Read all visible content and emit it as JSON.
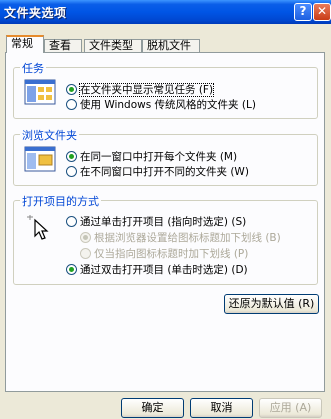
{
  "window": {
    "title": "文件夹选项",
    "help_glyph": "?",
    "close_glyph": "✕"
  },
  "tabs": [
    {
      "label": "常规",
      "active": true
    },
    {
      "label": "查看",
      "active": false
    },
    {
      "label": "文件类型",
      "active": false
    },
    {
      "label": "脱机文件",
      "active": false
    }
  ],
  "tasks": {
    "title": "任务",
    "icon": "tasks-window-icon",
    "options": [
      {
        "label": "在文件夹中显示常见任务 (F)",
        "checked": true
      },
      {
        "label": "使用 Windows 传统风格的文件夹 (L)",
        "checked": false
      }
    ]
  },
  "browse": {
    "title": "浏览文件夹",
    "icon": "browse-windows-icon",
    "options": [
      {
        "label": "在同一窗口中打开每个文件夹 (M)",
        "checked": true
      },
      {
        "label": "在不同窗口中打开不同的文件夹 (W)",
        "checked": false
      }
    ]
  },
  "click": {
    "title": "打开项目的方式",
    "icon": "pointer-click-icon",
    "options": [
      {
        "label": "通过单击打开项目 (指向时选定) (S)",
        "checked": false
      },
      {
        "label": "根据浏览器设置给图标标题加下划线 (B)",
        "checked": true,
        "disabled": true
      },
      {
        "label": "仅当指向图标标题时加下划线 (P)",
        "checked": false,
        "disabled": true
      },
      {
        "label": "通过双击打开项目 (单击时选定) (D)",
        "checked": true
      }
    ]
  },
  "restore_button": "还原为默认值 (R)",
  "footer": {
    "ok": "确定",
    "cancel": "取消",
    "apply": "应用 (A)"
  },
  "colors": {
    "title_bar": "#0055e5",
    "group_title": "#0046d5",
    "dialog_bg": "#ece9d8",
    "active_tab_accent": "#e68b2c"
  }
}
